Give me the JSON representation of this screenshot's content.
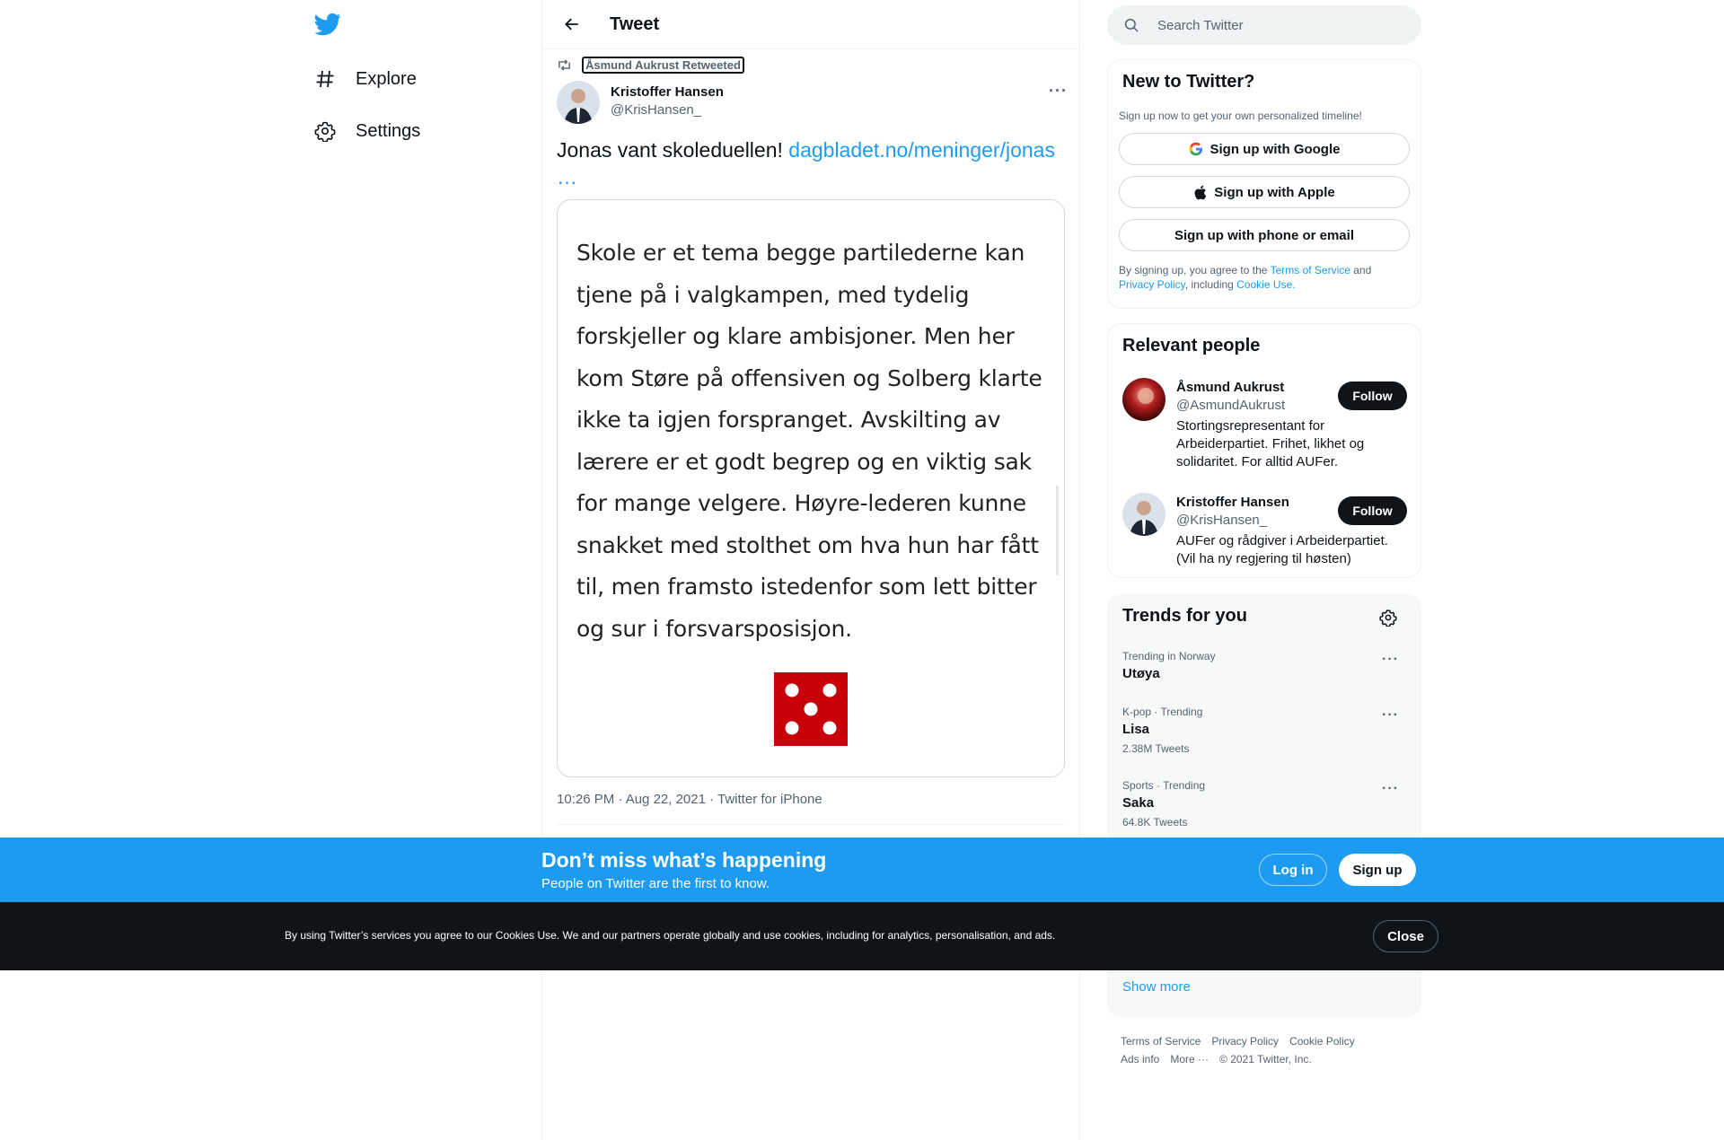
{
  "nav": {
    "logo_icon": "twitter-bird-icon",
    "items": [
      {
        "label": "Explore",
        "icon": "hashtag-icon"
      },
      {
        "label": "Settings",
        "icon": "gear-icon"
      }
    ]
  },
  "header": {
    "title": "Tweet",
    "back_icon": "arrow-left-icon"
  },
  "tweet": {
    "retweeted_by": "Åsmund Aukrust Retweeted",
    "author_name": "Kristoffer Hansen",
    "author_handle": "@KrisHansen_",
    "text": "Jonas vant skoleduellen! ",
    "link": "dagbladet.no/meninger/jonas",
    "link_ellipsis": "…",
    "media_text": "Skole er et tema begge partilederne kan tjene på i valgkampen, med tydelig forskjeller og klare ambisjoner. Men her kom Støre på offensiven og Solberg klarte ikke ta igjen forspranget. Avskilting av lærere er et godt begrep og en viktig sak for mange velgere. Høyre-lederen kunne snakket med stolthet om hva hun har fått til, men framsto istedenfor som lett bitter og sur i forsvarsposisjon.",
    "dice_icon": "dice-five-icon",
    "meta": "10:26 PM · Aug 22, 2021 · Twitter for iPhone"
  },
  "search": {
    "placeholder": "Search Twitter"
  },
  "signup_card": {
    "title": "New to Twitter?",
    "subtitle": "Sign up now to get your own personalized timeline!",
    "google": "Sign up with Google",
    "apple": "Sign up with Apple",
    "phone": "Sign up with phone or email",
    "legal_1": "By signing up, you agree to the ",
    "legal_terms": "Terms of Service",
    "legal_2": " and ",
    "legal_privacy": "Privacy Policy",
    "legal_3": ", including ",
    "legal_cookie": "Cookie Use."
  },
  "relevant": {
    "title": "Relevant people",
    "people": [
      {
        "name": "Åsmund Aukrust",
        "handle": "@AsmundAukrust",
        "bio": "Stortingsrepresentant for Arbeiderpartiet. Frihet, likhet og solidaritet. For alltid AUFer.",
        "button": "Follow"
      },
      {
        "name": "Kristoffer Hansen",
        "handle": "@KrisHansen_",
        "bio": "AUFer og rådgiver i Arbeiderpartiet. (Vil ha ny regjering til høsten)",
        "button": "Follow"
      }
    ]
  },
  "trends": {
    "title": "Trends for you",
    "items": [
      {
        "context": "Trending in Norway",
        "name": "Utøya",
        "count": ""
      },
      {
        "context": "K-pop · Trending",
        "name": "Lisa",
        "count": "2.38M Tweets"
      },
      {
        "context": "Sports · Trending",
        "name": "Saka",
        "count": "64.8K Tweets"
      }
    ],
    "show_more": "Show more"
  },
  "footer": {
    "terms": "Terms of Service",
    "privacy": "Privacy Policy",
    "cookie": "Cookie Policy",
    "ads": "Ads info",
    "more": "More ···",
    "copyright": "© 2021 Twitter, Inc."
  },
  "banner": {
    "headline": "Don’t miss what’s happening",
    "sub": "People on Twitter are the first to know.",
    "login": "Log in",
    "signup": "Sign up"
  },
  "cookie_bar": {
    "text": "By using Twitter’s services you agree to our Cookies Use. We and our partners operate globally and use cookies, including for analytics, personalisation, and ads.",
    "close": "Close"
  },
  "colors": {
    "accent": "#1d9bf0",
    "text": "#0f1419",
    "muted": "#536471",
    "dice": "#c8000a"
  }
}
